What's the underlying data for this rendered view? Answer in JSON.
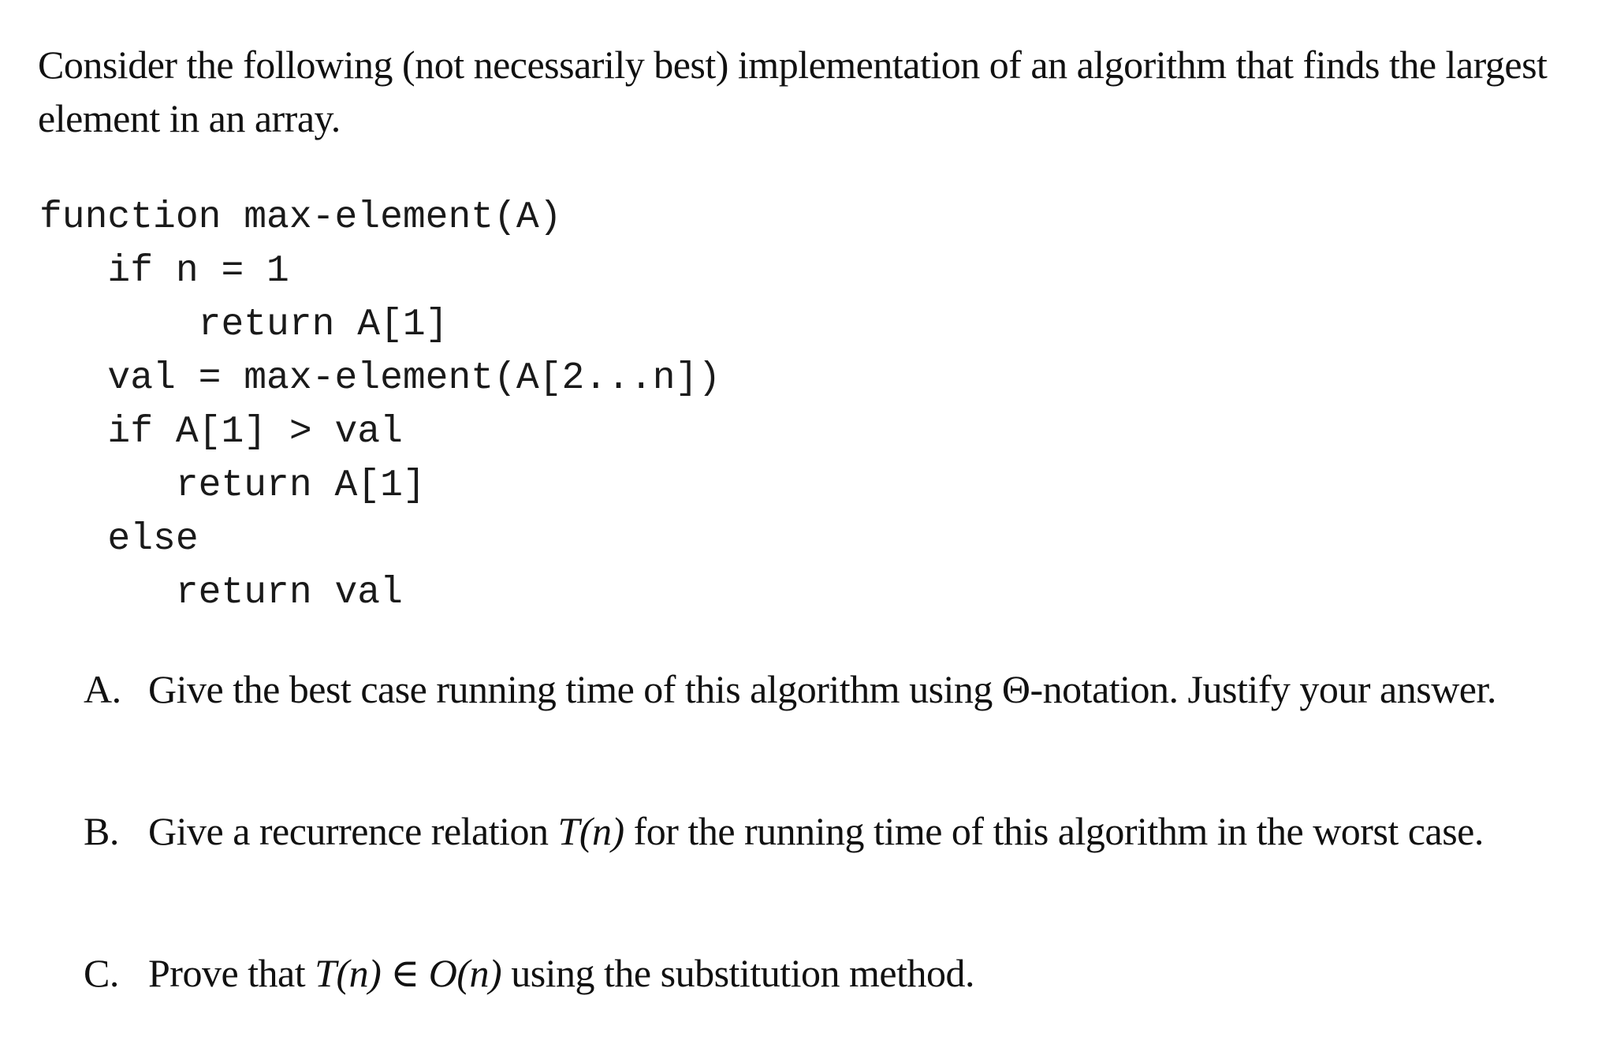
{
  "intro": {
    "text": "Consider the following (not necessarily best) implementation of an algorithm that finds the largest element in an array."
  },
  "code": {
    "lines": [
      "function max-element(A)",
      "   if n = 1",
      "       return A[1]",
      "   val = max-element(A[2...n])",
      "   if A[1] > val",
      "      return A[1]",
      "   else",
      "      return val"
    ]
  },
  "questions": [
    {
      "label": "A.",
      "text": "Give the best case running time of this algorithm using Θ-notation. Justify your answer."
    },
    {
      "label": "B.",
      "text_before": "Give a recurrence relation ",
      "math": "T(n)",
      "text_after": " for the running time of this algorithm in the worst case."
    },
    {
      "label": "C.",
      "text_before": "Prove that ",
      "math_1": "T(n)",
      "symbol": " ∈ ",
      "math_2": "O(n)",
      "text_after": " using the substitution method."
    }
  ]
}
